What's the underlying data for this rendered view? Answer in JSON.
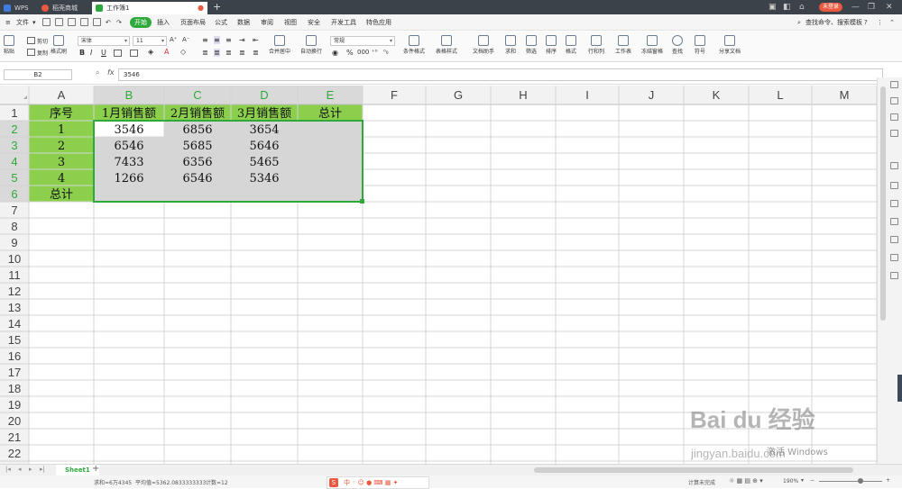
{
  "titlebar": {
    "tabs": [
      {
        "label": "WPS"
      },
      {
        "label": "稻壳商城"
      },
      {
        "label": "工作簿1"
      }
    ],
    "login_label": "未登录"
  },
  "menubar": {
    "file_label": "文件",
    "items": [
      "开始",
      "插入",
      "页面布局",
      "公式",
      "数据",
      "审阅",
      "视图",
      "安全",
      "开发工具",
      "特色应用"
    ],
    "search_label": "查找命令、搜索模板"
  },
  "ribbon": {
    "paste": "粘贴",
    "cut": "剪切",
    "copy": "复制",
    "format_painter": "格式刷",
    "font_name": "宋体",
    "font_size": "11",
    "merge_center": "合并居中",
    "wrap_text": "自动换行",
    "number_format": "常规",
    "conditional_format": "条件格式",
    "table_style": "表格样式",
    "doc_assistant": "文档助手",
    "sum": "求和",
    "filter": "筛选",
    "sort": "排序",
    "format": "格式",
    "row_col": "行和列",
    "worksheet": "工作表",
    "freeze": "冻结窗格",
    "find": "查找",
    "symbol": "符号",
    "share": "分享文档"
  },
  "formula_bar": {
    "cell_ref": "B2",
    "fx": "fx",
    "content": "3546"
  },
  "sheet": {
    "columns": [
      "A",
      "B",
      "C",
      "D",
      "E",
      "F",
      "G",
      "H",
      "I",
      "J",
      "K",
      "L",
      "M"
    ],
    "rows": [
      "1",
      "2",
      "3",
      "4",
      "5",
      "6",
      "7",
      "8",
      "9",
      "10",
      "11",
      "12",
      "13",
      "14",
      "15",
      "16",
      "17",
      "18",
      "19",
      "20",
      "21",
      "22"
    ],
    "cells": [
      [
        "序号",
        "1月销售额",
        "2月销售额",
        "3月销售额",
        "总计"
      ],
      [
        "1",
        "3546",
        "6856",
        "3654",
        ""
      ],
      [
        "2",
        "6546",
        "5685",
        "5646",
        ""
      ],
      [
        "3",
        "7433",
        "6356",
        "5465",
        ""
      ],
      [
        "4",
        "1266",
        "6546",
        "5346",
        ""
      ],
      [
        "总计",
        "",
        "",
        "",
        ""
      ]
    ],
    "green": "#8ccf4d",
    "selection_gray": "#d6d6d6",
    "selection_border": "#2fa93b"
  },
  "sheet_tabs": {
    "active": "Sheet1",
    "add": "+"
  },
  "statusbar": {
    "sum": "求和=6万4345",
    "average": "平均值=5362.0833333333",
    "count": "计数=12",
    "autosave": "计算未完成",
    "zoom": "190%"
  },
  "watermark": {
    "brand": "Bai du 经验",
    "url": "jingyan.baidu.com",
    "activate": "激活 Windows"
  }
}
